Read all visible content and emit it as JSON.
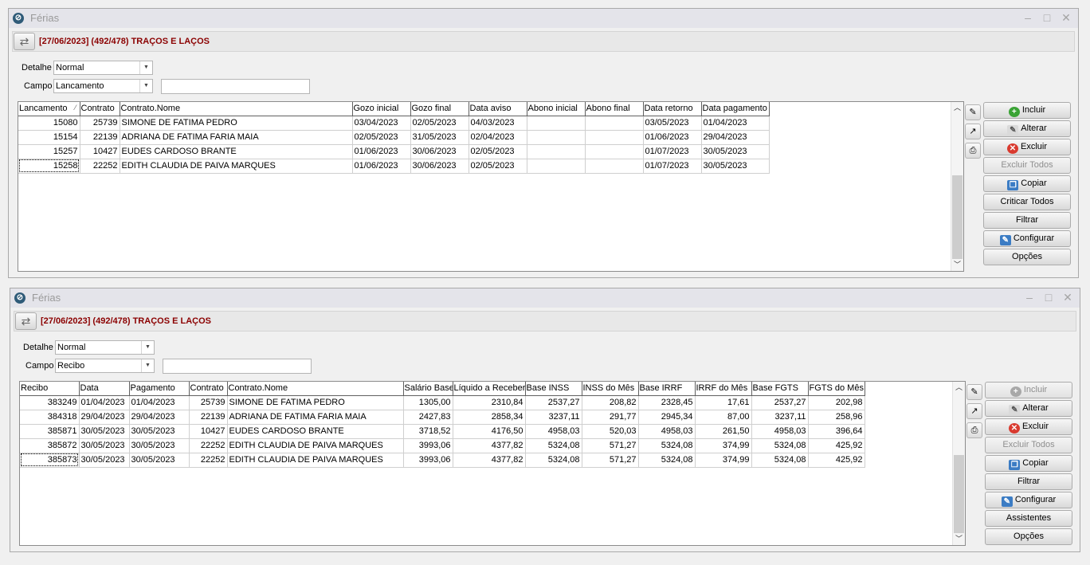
{
  "windows": [
    {
      "title": "Férias",
      "header_title": "[27/06/2023] (492/478) TRAÇOS E LAÇOS",
      "detalhe": {
        "label": "Detalhe",
        "value": "Normal"
      },
      "campo": {
        "label": "Campo",
        "value": "Lancamento"
      },
      "search_value": "",
      "columns": [
        "Lancamento",
        "Contrato",
        "Contrato.Nome",
        "Gozo inicial",
        "Gozo final",
        "Data aviso",
        "Abono inicial",
        "Abono final",
        "Data retorno",
        "Data pagamento"
      ],
      "rows": [
        [
          "15080",
          "25739",
          "SIMONE DE FATIMA PEDRO",
          "03/04/2023",
          "02/05/2023",
          "04/03/2023",
          "",
          "",
          "03/05/2023",
          "01/04/2023"
        ],
        [
          "15154",
          "22139",
          "ADRIANA DE FATIMA FARIA MAIA",
          "02/05/2023",
          "31/05/2023",
          "02/04/2023",
          "",
          "",
          "01/06/2023",
          "29/04/2023"
        ],
        [
          "15257",
          "10427",
          "EUDES CARDOSO BRANTE",
          "01/06/2023",
          "30/06/2023",
          "02/05/2023",
          "",
          "",
          "01/07/2023",
          "30/05/2023"
        ],
        [
          "15258",
          "22252",
          "EDITH CLAUDIA DE PAIVA MARQUES",
          "01/06/2023",
          "30/06/2023",
          "02/05/2023",
          "",
          "",
          "01/07/2023",
          "30/05/2023"
        ]
      ],
      "sort_indicator": "⁄",
      "buttons": [
        {
          "label": "Incluir",
          "icon": "plus-icon",
          "enabled": true
        },
        {
          "label": "Alterar",
          "icon": "edit-icon",
          "enabled": true
        },
        {
          "label": "Excluir",
          "icon": "delete-icon",
          "enabled": true
        },
        {
          "label": "Excluir Todos",
          "icon": "",
          "enabled": false
        },
        {
          "label": "Copiar",
          "icon": "copy-icon",
          "enabled": true
        },
        {
          "label": "Criticar Todos",
          "icon": "",
          "enabled": true
        },
        {
          "label": "Filtrar",
          "icon": "",
          "enabled": true
        },
        {
          "label": "Configurar",
          "icon": "configure-icon",
          "enabled": true
        },
        {
          "label": "Opções",
          "icon": "",
          "enabled": true
        }
      ]
    },
    {
      "title": "Férias",
      "header_title": "[27/06/2023] (492/478) TRAÇOS E LAÇOS",
      "detalhe": {
        "label": "Detalhe",
        "value": "Normal"
      },
      "campo": {
        "label": "Campo",
        "value": "Recibo"
      },
      "search_value": "",
      "columns": [
        "Recibo",
        "Data",
        "Pagamento",
        "Contrato",
        "Contrato.Nome",
        "Salário Base",
        "Líquido a Receber",
        "Base INSS",
        "INSS do Mês",
        "Base IRRF",
        "IRRF do Mês",
        "Base FGTS",
        "FGTS do Mês"
      ],
      "rows": [
        [
          "383249",
          "01/04/2023",
          "01/04/2023",
          "25739",
          "SIMONE DE FATIMA PEDRO",
          "1305,00",
          "2310,84",
          "2537,27",
          "208,82",
          "2328,45",
          "17,61",
          "2537,27",
          "202,98"
        ],
        [
          "384318",
          "29/04/2023",
          "29/04/2023",
          "22139",
          "ADRIANA DE FATIMA FARIA MAIA",
          "2427,83",
          "2858,34",
          "3237,11",
          "291,77",
          "2945,34",
          "87,00",
          "3237,11",
          "258,96"
        ],
        [
          "385871",
          "30/05/2023",
          "30/05/2023",
          "10427",
          "EUDES CARDOSO BRANTE",
          "3718,52",
          "4176,50",
          "4958,03",
          "520,03",
          "4958,03",
          "261,50",
          "4958,03",
          "396,64"
        ],
        [
          "385872",
          "30/05/2023",
          "30/05/2023",
          "22252",
          "EDITH CLAUDIA DE PAIVA MARQUES",
          "3993,06",
          "4377,82",
          "5324,08",
          "571,27",
          "5324,08",
          "374,99",
          "5324,08",
          "425,92"
        ],
        [
          "385873",
          "30/05/2023",
          "30/05/2023",
          "22252",
          "EDITH CLAUDIA DE PAIVA MARQUES",
          "3993,06",
          "4377,82",
          "5324,08",
          "571,27",
          "5324,08",
          "374,99",
          "5324,08",
          "425,92"
        ]
      ],
      "sort_indicator": "",
      "buttons": [
        {
          "label": "Incluir",
          "icon": "plus-icon",
          "enabled": false
        },
        {
          "label": "Alterar",
          "icon": "edit-icon",
          "enabled": true
        },
        {
          "label": "Excluir",
          "icon": "delete-icon",
          "enabled": true
        },
        {
          "label": "Excluir Todos",
          "icon": "",
          "enabled": false
        },
        {
          "label": "Copiar",
          "icon": "copy-icon",
          "enabled": true
        },
        {
          "label": "Filtrar",
          "icon": "",
          "enabled": true
        },
        {
          "label": "Configurar",
          "icon": "configure-icon",
          "enabled": true
        },
        {
          "label": "Assistentes",
          "icon": "",
          "enabled": true
        },
        {
          "label": "Opções",
          "icon": "",
          "enabled": true
        }
      ]
    }
  ],
  "colors": {
    "header_title": "#8b0000",
    "window_bg": "#f0f0f0",
    "titlebar_bg": "#e4e4ea"
  }
}
